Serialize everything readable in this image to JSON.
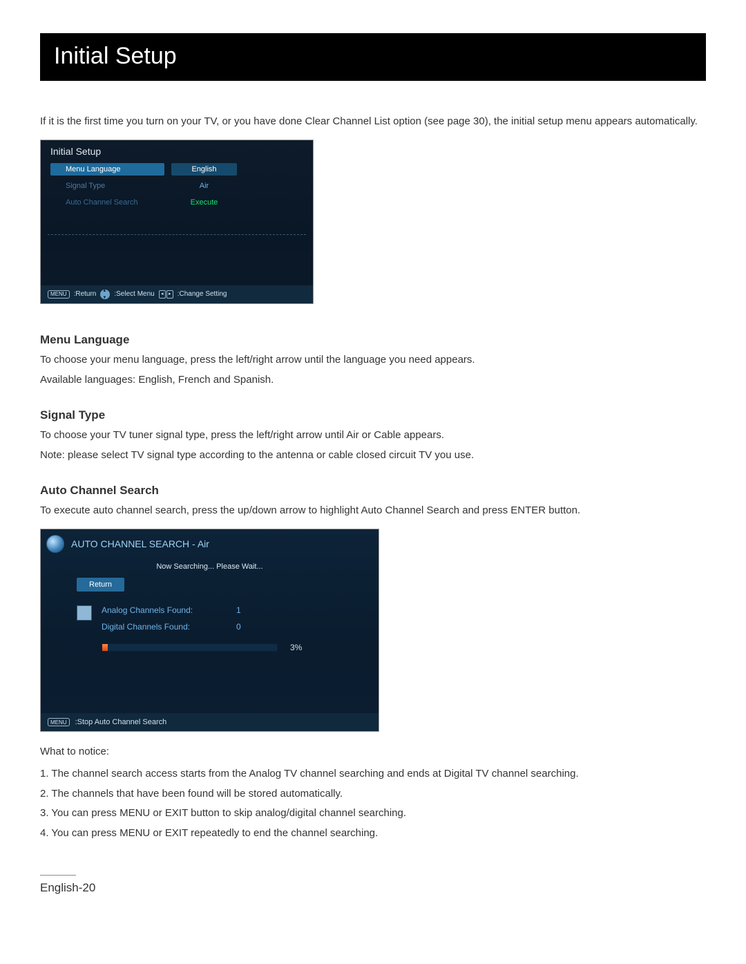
{
  "page": {
    "title": "Initial Setup",
    "intro": "If it is the first time you turn on your TV, or you have done Clear Channel List option (see page 30), the initial setup menu appears automatically.",
    "footer": "English-20"
  },
  "osd_initial": {
    "title": "Initial Setup",
    "rows": [
      {
        "label": "Menu Language",
        "value": "English",
        "selected": true,
        "muted": false
      },
      {
        "label": "Signal Type",
        "value": "Air",
        "selected": false,
        "muted": false
      },
      {
        "label": "Auto Channel Search",
        "value": "Execute",
        "selected": false,
        "muted": true
      }
    ],
    "footer": {
      "menu_btn": "MENU",
      "return": ":Return",
      "select": ":Select Menu",
      "change": ":Change Setting"
    }
  },
  "sections": {
    "menu_language": {
      "heading": "Menu Language",
      "body1": "To choose your menu language, press the left/right arrow until the language you need appears.",
      "body2": "Available languages: English, French and Spanish."
    },
    "signal_type": {
      "heading": "Signal Type",
      "body1": "To choose your TV tuner signal type, press the left/right arrow until Air or Cable appears.",
      "body2": "Note: please select TV signal type according to the antenna or cable closed circuit TV you use."
    },
    "auto_search": {
      "heading": "Auto Channel Search",
      "body1": "To execute auto channel search, press the up/down arrow to highlight Auto Channel Search and press ENTER button."
    }
  },
  "osd_search": {
    "title": "AUTO CHANNEL SEARCH - Air",
    "subtitle": "Now Searching... Please Wait...",
    "return_label": "Return",
    "found": {
      "analog_label": "Analog Channels Found:",
      "analog_value": "1",
      "digital_label": "Digital Channels Found:",
      "digital_value": "0"
    },
    "progress_pct": "3%",
    "footer": {
      "menu_btn": "MENU",
      "stop": ":Stop Auto Channel Search"
    }
  },
  "notices": {
    "heading": "What to notice:",
    "items": [
      "1. The channel search access starts from the Analog TV channel searching and ends at Digital TV channel searching.",
      "2. The channels that have been found will be stored automatically.",
      "3. You can press MENU or EXIT button to skip analog/digital channel searching.",
      "4. You can press MENU or EXIT repeatedly to end the channel searching."
    ]
  }
}
